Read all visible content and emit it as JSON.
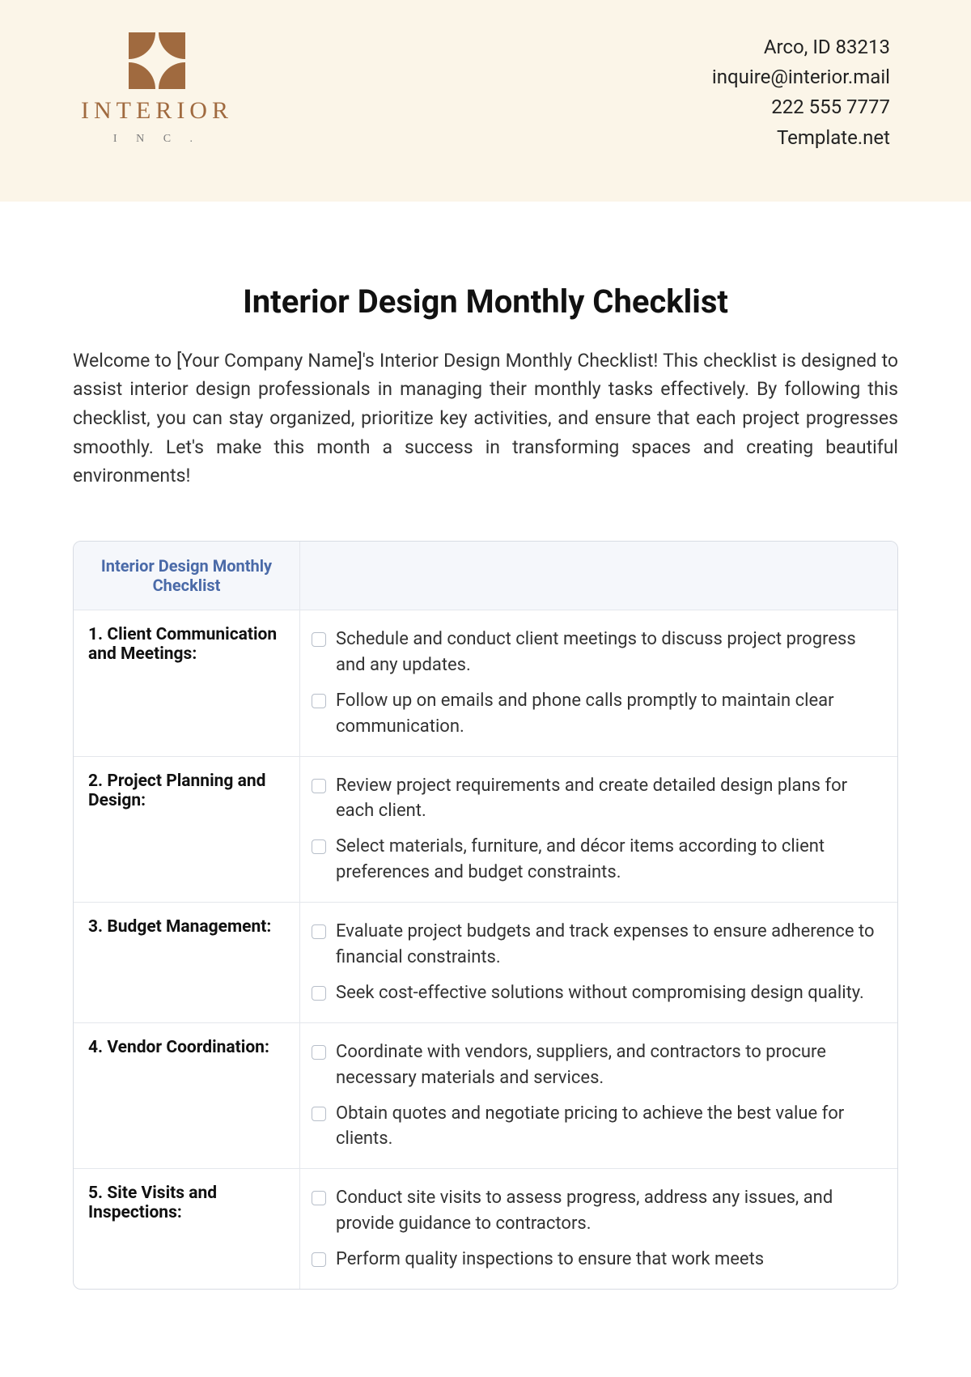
{
  "header": {
    "brand_name": "INTERIOR",
    "brand_sub": "I N C .",
    "contact": {
      "address": "Arco, ID 83213",
      "email": "inquire@interior.mail",
      "phone": "222 555 7777",
      "site": "Template.net"
    }
  },
  "title": "Interior Design Monthly Checklist",
  "intro": "Welcome to [Your Company Name]'s Interior Design Monthly Checklist! This checklist is designed to assist interior design professionals in managing their monthly tasks effectively. By following this checklist, you can stay organized, prioritize key activities, and ensure that each project progresses smoothly. Let's make this month a success in transforming spaces and creating beautiful environments!",
  "table_header": "Interior Design Monthly Checklist",
  "sections": [
    {
      "label": "1. Client Communication and Meetings:",
      "tasks": [
        "Schedule and conduct client meetings to discuss project progress and any updates.",
        "Follow up on emails and phone calls promptly to maintain clear communication."
      ]
    },
    {
      "label": "2. Project Planning and Design:",
      "tasks": [
        "Review project requirements and create detailed design plans for each client.",
        "Select materials, furniture, and décor items according to client preferences and budget constraints."
      ]
    },
    {
      "label": "3. Budget Management:",
      "tasks": [
        "Evaluate project budgets and track expenses to ensure adherence to financial constraints.",
        "Seek cost-effective solutions without compromising design quality."
      ]
    },
    {
      "label": "4. Vendor Coordination:",
      "tasks": [
        "Coordinate with vendors, suppliers, and contractors to procure necessary materials and services.",
        "Obtain quotes and negotiate pricing to achieve the best value for clients."
      ]
    },
    {
      "label": "5. Site Visits and Inspections:",
      "tasks": [
        "Conduct site visits to assess progress, address any issues, and provide guidance to contractors.",
        "Perform quality inspections to ensure that work meets"
      ]
    }
  ]
}
